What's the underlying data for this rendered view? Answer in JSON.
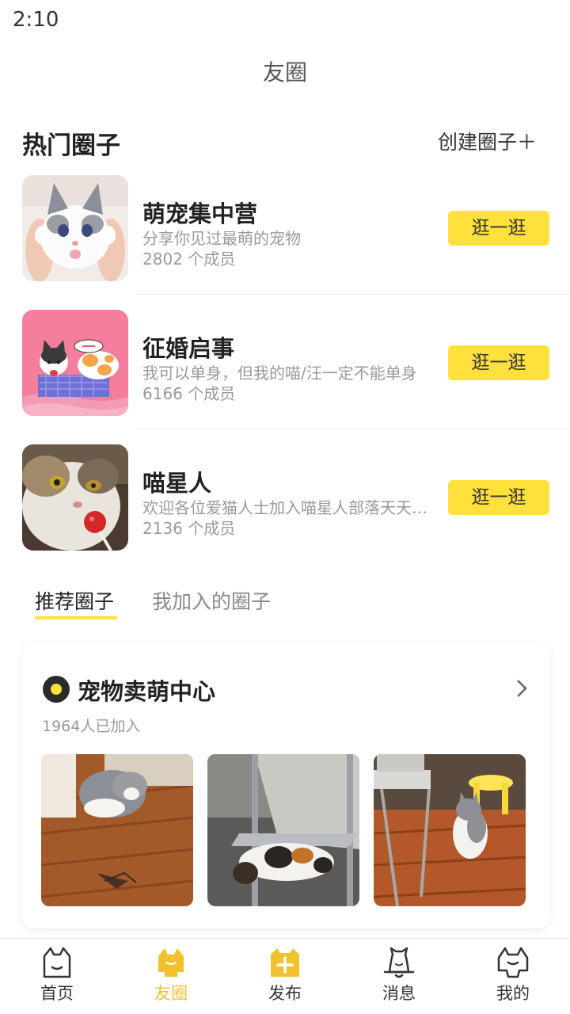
{
  "status_bar": {
    "time": "2:10"
  },
  "header": {
    "title": "友圈"
  },
  "hot_section": {
    "title": "热门圈子",
    "create_label": "创建圈子＋",
    "items": [
      {
        "name": "萌宠集中营",
        "desc": "分享你见过最萌的宠物",
        "members": "2802 个成员",
        "button": "逛一逛"
      },
      {
        "name": "征婚启事",
        "desc": "我可以单身，但我的喵/汪一定不能单身",
        "members": "6166 个成员",
        "button": "逛一逛"
      },
      {
        "name": "喵星人",
        "desc": "欢迎各位爱猫人士加入喵星人部落天天开心",
        "members": "2136 个成员",
        "button": "逛一逛"
      }
    ]
  },
  "tabs": [
    {
      "label": "推荐圈子",
      "active": true
    },
    {
      "label": "我加入的圈子",
      "active": false
    }
  ],
  "recommend_card": {
    "title": "宠物卖萌中心",
    "joined": "1964人已加入",
    "accent": "#ffe03d"
  },
  "bottom_nav": {
    "items": [
      {
        "label": "首页",
        "icon": "cat-home-icon"
      },
      {
        "label": "友圈",
        "icon": "cat-circle-icon",
        "active": true
      },
      {
        "label": "发布",
        "icon": "publish-plus-icon"
      },
      {
        "label": "消息",
        "icon": "bell-cat-icon"
      },
      {
        "label": "我的",
        "icon": "cat-profile-icon"
      }
    ],
    "active_color": "#f2c12e"
  }
}
